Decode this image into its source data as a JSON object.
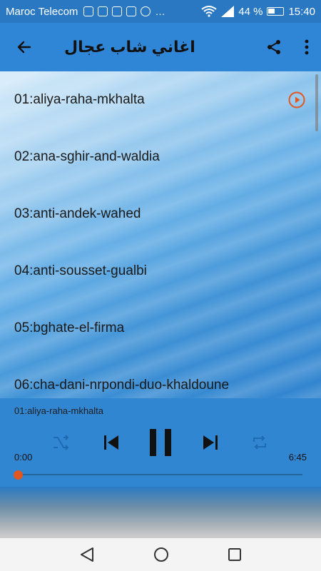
{
  "status_bar": {
    "carrier": "Maroc Telecom",
    "battery": "44 %",
    "time": "15:40",
    "dots": "…"
  },
  "app_bar": {
    "title": "اغاني شاب عجال"
  },
  "tracks": [
    "01:aliya-raha-mkhalta",
    "02:ana-sghir-and-waldia",
    "03:anti-andek-wahed",
    "04:anti-sousset-gualbi",
    "05:bghate-el-firma",
    "06:cha-dani-nrpondi-duo-khaldoune"
  ],
  "player": {
    "now_playing": "01:aliya-raha-mkhalta",
    "current_time": "0:00",
    "total_time": "6:45",
    "progress": 0.0
  },
  "colors": {
    "accent": "#e2571f",
    "app_bar": "#2f86d6",
    "player_bg": "#3186d2"
  }
}
